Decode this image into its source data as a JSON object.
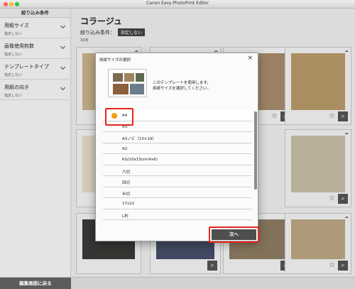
{
  "window": {
    "title": "Canon Easy-PhotoPrint Editor"
  },
  "sidebar": {
    "header": "絞り込み条件",
    "items": [
      {
        "title": "用紙サイズ",
        "value": "指定しない"
      },
      {
        "title": "画像使用枚数",
        "value": "指定しない"
      },
      {
        "title": "テンプレートタイプ",
        "value": "指定しない"
      },
      {
        "title": "用紙の向き",
        "value": "指定しない"
      }
    ]
  },
  "main": {
    "title": "コラージュ",
    "filter_label": "絞り込み条件：",
    "filter_value": "指定しない",
    "count": "10点"
  },
  "bottom": {
    "back_label": "編集画面に戻る"
  },
  "dialog": {
    "title": "用紙サイズの選択",
    "close": "×",
    "message_line1": "このテンプレートを使用します。",
    "message_line2": "用紙サイズを選択してください。",
    "sizes": [
      "A4",
      "A3",
      "A3ノビ（13×19）",
      "A2",
      "KG/10x15cm(4x6)",
      "六切",
      "四切",
      "半切",
      "17x22",
      "L判"
    ],
    "selected": "A4",
    "next_label": "次へ"
  },
  "colors": {
    "accent": "#f29500",
    "highlight": "#e8231c",
    "button": "#4e4e4e"
  }
}
